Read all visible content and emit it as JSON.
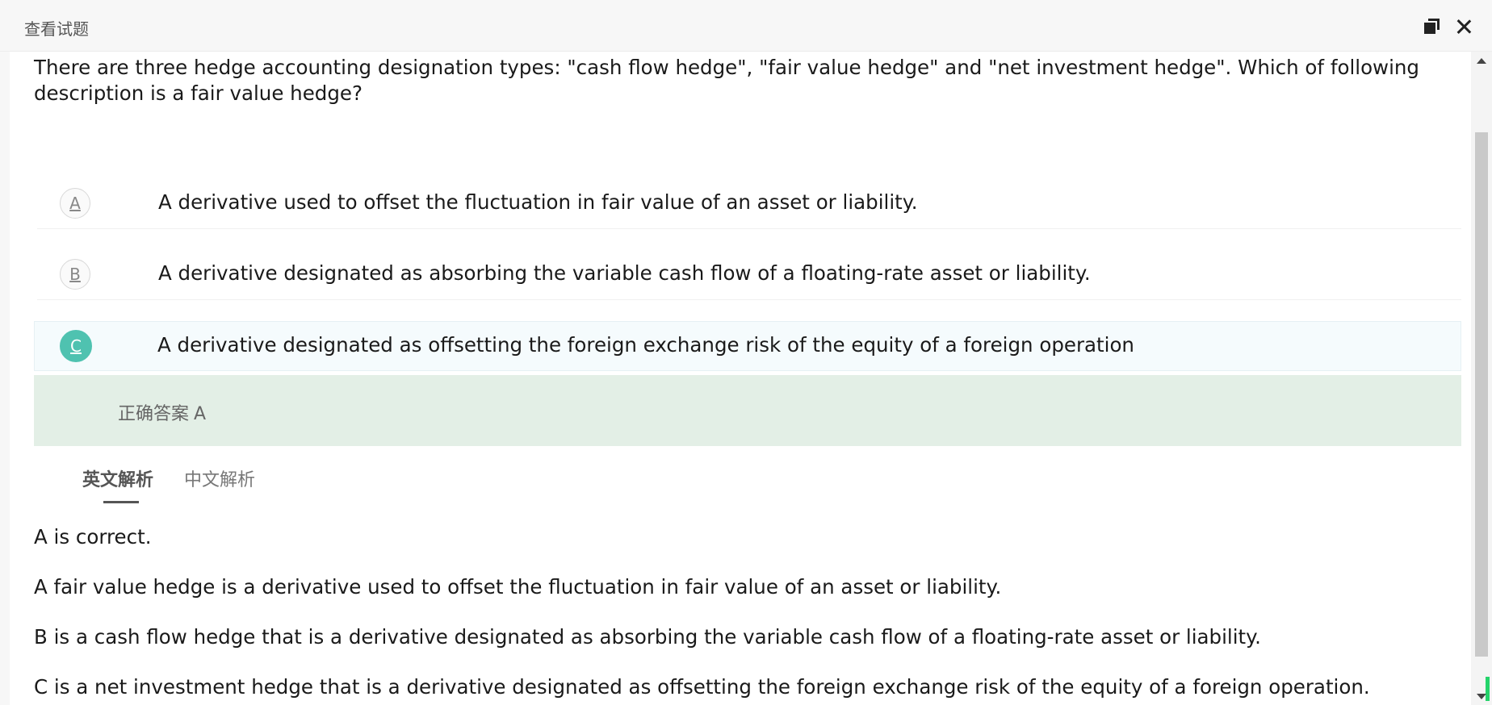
{
  "window": {
    "title": "查看试题"
  },
  "question": {
    "text": "There are three hedge accounting designation types: \"cash flow hedge\", \"fair value hedge\" and \"net investment hedge\". Which of following description is a fair value hedge?"
  },
  "options": [
    {
      "letter": "A",
      "text": "A derivative used to offset the fluctuation in fair value of an asset or liability.",
      "selected": false
    },
    {
      "letter": "B",
      "text": "A derivative designated as absorbing the variable cash flow of a floating-rate asset or liability.",
      "selected": false
    },
    {
      "letter": "C",
      "text": "A derivative designated as offsetting the foreign exchange risk of the equity of a foreign operation",
      "selected": true
    }
  ],
  "answer": {
    "label": "正确答案",
    "value": "A"
  },
  "tabs": {
    "english": "英文解析",
    "chinese": "中文解析",
    "active": "english"
  },
  "explanation": {
    "lines": [
      "A is correct.",
      "A fair value hedge is a derivative used to offset the fluctuation in fair value of an asset or liability.",
      "B is a cash flow hedge that is a derivative designated as absorbing the variable cash flow of a floating-rate asset or liability.",
      "C is a net investment hedge that is a derivative designated as offsetting the foreign exchange risk of the equity of a foreign operation."
    ]
  },
  "colors": {
    "selected_circle": "#4fc2b0",
    "answer_band": "#e3efe6",
    "scroll_indicator": "#24d36a"
  }
}
